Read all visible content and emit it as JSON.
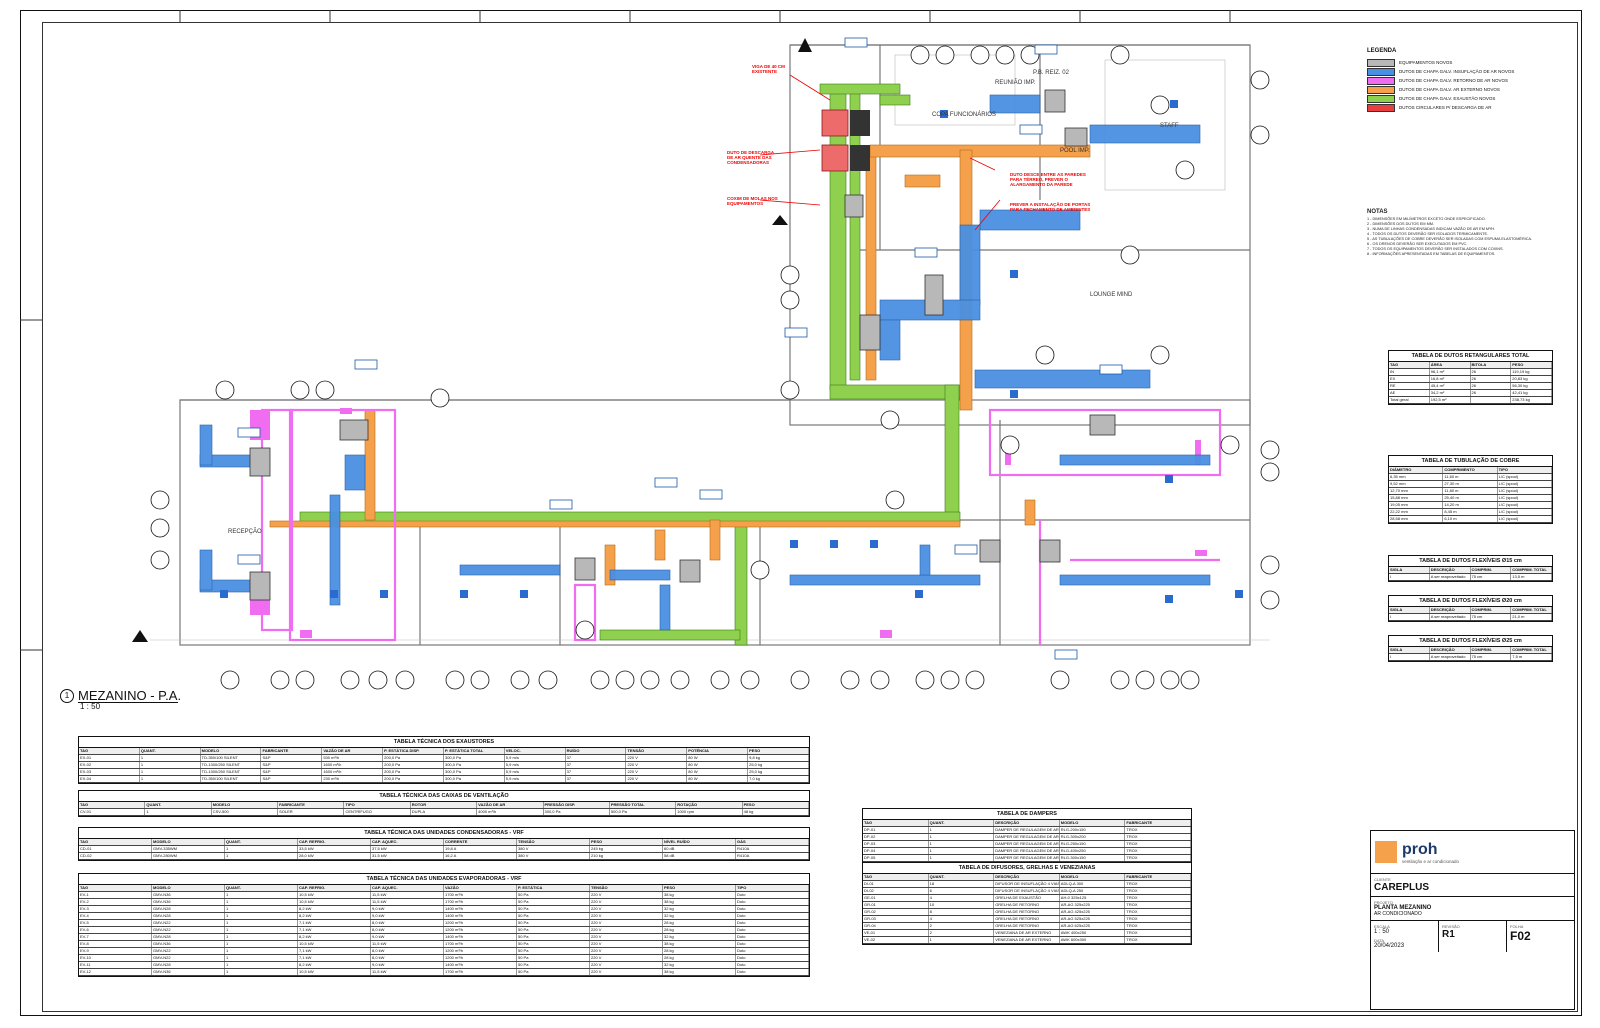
{
  "view": {
    "number": "1",
    "title": "MEZANINO - P.A.",
    "scale": "1 : 50"
  },
  "rooms": {
    "copa": "COPA FUNCIONÁRIOS",
    "reuniao": "REUNIÃO IMP.",
    "pbreiz": "P.B. REIZ. 02",
    "staff": "STAFF",
    "pool": "POOL IMP.",
    "lounge": "LOUNGE MIND",
    "recepcao": "RECEPÇÃO"
  },
  "red_notes": [
    "VIGA DE 40 CM EXISTENTE",
    "DUTO DE DESCARGA DE AR QUENTE DAS CONDENSADORAS",
    "COXIM DE MOLAS NOS EQUIPAMENTOS",
    "DUTO DESCE ENTRE AS PAREDES PARA TÉRREO, PREVER O ALARGAMENTO DA PAREDE",
    "PREVER A INSTALAÇÃO DE PORTAS PARA FECHAMENTO DE AMBIENTES"
  ],
  "legend": {
    "title": "LEGENDA",
    "items": [
      {
        "label": "EQUIPAMENTOS NOVOS",
        "color": "#b8b8b8"
      },
      {
        "label": "DUTOS DE CHAPA GALV. INSUFLAÇÃO DE AR NOVOS",
        "color": "#4a90e2"
      },
      {
        "label": "DUTOS DE CHAPA GALV. RETORNO DE AR NOVOS",
        "color": "#f06cf0"
      },
      {
        "label": "DUTOS DE CHAPA GALV. AR EXTERNO NOVOS",
        "color": "#f5a04a"
      },
      {
        "label": "DUTOS DE CHAPA GALV. EXAUSTÃO NOVOS",
        "color": "#8fd14f"
      },
      {
        "label": "DUTOS CIRCULARES P/ DESCARGA DE AR",
        "color": "#e84040"
      }
    ]
  },
  "notes": {
    "title": "NOTAS",
    "lines": [
      "1 - DIMENSÕES EM MILÍMETROS EXCETO ONDE ESPECIFICADO.",
      "2 - DIMENSÕES DOS DUTOS EM MM.",
      "3 - NUMA DE LINHAS CONDENSADAS INDICAM VAZÃO DE AR EM M³/H.",
      "4 - TODOS OS DUTOS DEVERÃO SER ISOLADOS TERMICAMENTE.",
      "5 - AS TUBULAÇÕES DE COBRE DEVERÃO SER ISOLADAS COM ESPUMA ELASTOMÉRICA.",
      "6 - OS DRENOS DEVERÃO SER EXECUTADOS EM PVC.",
      "7 - TODOS OS EQUIPAMENTOS DEVERÃO SER INSTALADOS COM COXINS.",
      "8 - INFORMAÇÕES APRESENTADAS EM TABELAS DE EQUIPAMENTOS."
    ]
  },
  "tables": {
    "retangulares": {
      "title": "TABELA DE DUTOS RETANGULARES TOTAL",
      "header": [
        "TAG",
        "ÁREA",
        "BITOLA",
        "PESO"
      ],
      "rows": [
        [
          "IN",
          "96,1 m²",
          "26",
          "119,19 kg"
        ],
        [
          "EX",
          "16,8 m²",
          "26",
          "20,83 kg"
        ],
        [
          "RE",
          "45,4 m²",
          "26",
          "56,30 kg"
        ],
        [
          "AE",
          "34,2 m²",
          "26",
          "42,41 kg"
        ],
        [
          "Total geral",
          "192,5 m²",
          "",
          "238,73 kg"
        ]
      ]
    },
    "cobre": {
      "title": "TABELA DE TUBULAÇÃO DE COBRE",
      "header": [
        "DIÂMETRO",
        "COMPRIMENTO",
        "TIPO"
      ],
      "rows": [
        [
          "6,35 mm",
          "11,60 m",
          "L/C (spool)"
        ],
        [
          "9,52 mm",
          "27,30 m",
          "L/C (spool)"
        ],
        [
          "12,70 mm",
          "11,80 m",
          "L/C (spool)"
        ],
        [
          "15,88 mm",
          "25,40 m",
          "L/C (spool)"
        ],
        [
          "19,05 mm",
          "14,20 m",
          "L/C (spool)"
        ],
        [
          "22,22 mm",
          "8,45 m",
          "L/C (spool)"
        ],
        [
          "28,58 mm",
          "6,10 m",
          "L/C (spool)"
        ]
      ]
    },
    "flex15": {
      "title": "TABELA DE DUTOS FLEXÍVEIS Ø15 cm",
      "header": [
        "SIGLA",
        "DESCRIÇÃO",
        "COMPRIM.",
        "COMPRIM. TOTAL"
      ],
      "rows": [
        [
          "I",
          "A ser reaproveitado",
          "75 cm",
          "13,5 m"
        ]
      ]
    },
    "flex20": {
      "title": "TABELA DE DUTOS FLEXÍVEIS Ø20 cm",
      "header": [
        "SIGLA",
        "DESCRIÇÃO",
        "COMPRIM.",
        "COMPRIM. TOTAL"
      ],
      "rows": [
        [
          "I",
          "A ser reaproveitado",
          "75 cm",
          "21,0 m"
        ]
      ]
    },
    "flex25": {
      "title": "TABELA DE DUTOS FLEXÍVEIS Ø25 cm",
      "header": [
        "SIGLA",
        "DESCRIÇÃO",
        "COMPRIM.",
        "COMPRIM. TOTAL"
      ],
      "rows": [
        [
          "I",
          "A ser reaproveitado",
          "75 cm",
          "7,5 m"
        ]
      ]
    },
    "exaustores": {
      "title": "TABELA TÉCNICA DOS EXAUSTORES",
      "header": [
        "TAG",
        "QUANT.",
        "MODELO",
        "FABRICANTE",
        "VAZÃO DE AR",
        "P. ESTÁTICA DISP.",
        "P. ESTÁTICA TOTAL",
        "VELOC.",
        "RUÍDO",
        "TENSÃO",
        "POTÊNCIA",
        "PESO"
      ],
      "rows": [
        [
          "EX-01",
          "1",
          "TD-350/100 SILENT",
          "S&P",
          "530 m³/h",
          "200,0 Pa",
          "300,0 Pa",
          "5,9 m/s",
          "37",
          "220 V",
          "80 W",
          "9,8 kg"
        ],
        [
          "EX-02",
          "1",
          "TD-1300/250 SILENT",
          "S&P",
          "1600 m³/h",
          "200,0 Pa",
          "300,0 Pa",
          "5,9 m/s",
          "37",
          "220 V",
          "80 W",
          "25,0 kg"
        ],
        [
          "EX-03",
          "1",
          "TD-1300/250 SILENT",
          "S&P",
          "1600 m³/h",
          "200,0 Pa",
          "300,0 Pa",
          "5,9 m/s",
          "37",
          "220 V",
          "80 W",
          "25,0 kg"
        ],
        [
          "EX-04",
          "1",
          "TD-350/100 SILENT",
          "S&P",
          "230 m³/h",
          "200,0 Pa",
          "300,0 Pa",
          "5,9 m/s",
          "37",
          "220 V",
          "80 W",
          "7,0 kg"
        ]
      ]
    },
    "caixas": {
      "title": "TABELA TÉCNICA DAS CAIXAS DE VENTILAÇÃO",
      "header": [
        "TAG",
        "QUANT.",
        "MODELO",
        "FABRICANTE",
        "TIPO",
        "ROTOR",
        "VAZÃO DE AR",
        "PRESSÃO DISP.",
        "PRESSÃO TOTAL",
        "ROTAÇÃO",
        "PESO"
      ],
      "rows": [
        [
          "CV-01",
          "1",
          "CSV-500",
          "SOLER",
          "CENTRÍFUGO",
          "DUPLA",
          "4000 m³/h",
          "300,0 Pa",
          "500,0 Pa",
          "1000 rpm",
          "48 kg"
        ]
      ]
    },
    "condensadoras": {
      "title": "TABELA TÉCNICA DAS UNIDADES CONDENSADORAS - VRF",
      "header": [
        "TAG",
        "MODELO",
        "QUANT.",
        "CAP. REFRIG.",
        "CAP. AQUEC.",
        "CORRENTE",
        "TENSÃO",
        "PESO",
        "NÍVEL RUÍDO",
        "GÁS"
      ],
      "rows": [
        [
          "CD-01",
          "GMV-335WM",
          "1",
          "33,5 kW",
          "37,5 kW",
          "19,8 A",
          "380 V",
          "245 kg",
          "60 dB",
          "R410A"
        ],
        [
          "CD-02",
          "GMV-280WM",
          "1",
          "28,0 kW",
          "31,5 kW",
          "16,2 A",
          "380 V",
          "210 kg",
          "58 dB",
          "R410A"
        ]
      ]
    },
    "evaporadoras": {
      "title": "TABELA TÉCNICA DAS UNIDADES EVAPORADORAS - VRF",
      "header": [
        "TAG",
        "MODELO",
        "QUANT.",
        "CAP. REFRIG.",
        "CAP. AQUEC.",
        "VAZÃO",
        "P. ESTÁTICA",
        "TENSÃO",
        "PESO",
        "TIPO"
      ],
      "rows": [
        [
          "EV-1",
          "GMV-N36",
          "1",
          "10,5 kW",
          "11,5 kW",
          "1700 m³/h",
          "50 Pa",
          "220 V",
          "38 kg",
          "Duto"
        ],
        [
          "EV-2",
          "GMV-N36",
          "1",
          "10,5 kW",
          "11,5 kW",
          "1700 m³/h",
          "50 Pa",
          "220 V",
          "38 kg",
          "Duto"
        ],
        [
          "EV-3",
          "GMV-N28",
          "1",
          "8,2 kW",
          "9,0 kW",
          "1400 m³/h",
          "50 Pa",
          "220 V",
          "32 kg",
          "Duto"
        ],
        [
          "EV-4",
          "GMV-N28",
          "1",
          "8,2 kW",
          "9,0 kW",
          "1400 m³/h",
          "50 Pa",
          "220 V",
          "32 kg",
          "Duto"
        ],
        [
          "EV-5",
          "GMV-N22",
          "1",
          "7,1 kW",
          "8,0 kW",
          "1200 m³/h",
          "50 Pa",
          "220 V",
          "28 kg",
          "Duto"
        ],
        [
          "EV-6",
          "GMV-N22",
          "1",
          "7,1 kW",
          "8,0 kW",
          "1200 m³/h",
          "50 Pa",
          "220 V",
          "28 kg",
          "Duto"
        ],
        [
          "EV-7",
          "GMV-N28",
          "1",
          "8,2 kW",
          "9,0 kW",
          "1400 m³/h",
          "50 Pa",
          "220 V",
          "32 kg",
          "Duto"
        ],
        [
          "EV-8",
          "GMV-N36",
          "1",
          "10,5 kW",
          "11,5 kW",
          "1700 m³/h",
          "50 Pa",
          "220 V",
          "38 kg",
          "Duto"
        ],
        [
          "EV-9",
          "GMV-N22",
          "1",
          "7,1 kW",
          "8,0 kW",
          "1200 m³/h",
          "50 Pa",
          "220 V",
          "28 kg",
          "Duto"
        ],
        [
          "EV-10",
          "GMV-N22",
          "1",
          "7,1 kW",
          "8,0 kW",
          "1200 m³/h",
          "50 Pa",
          "220 V",
          "28 kg",
          "Duto"
        ],
        [
          "EV-11",
          "GMV-N28",
          "1",
          "8,2 kW",
          "9,0 kW",
          "1400 m³/h",
          "50 Pa",
          "220 V",
          "32 kg",
          "Duto"
        ],
        [
          "EV-12",
          "GMV-N36",
          "1",
          "10,5 kW",
          "11,5 kW",
          "1700 m³/h",
          "50 Pa",
          "220 V",
          "38 kg",
          "Duto"
        ]
      ]
    },
    "dampers": {
      "title": "TABELA DE DAMPERS",
      "header": [
        "TAG",
        "QUANT.",
        "DESCRIÇÃO",
        "MODELO",
        "FABRICANTE"
      ],
      "rows": [
        [
          "DP-01",
          "1",
          "DAMPER DE REGULAGEM DE AR",
          "RLG-200x150",
          "TROX"
        ],
        [
          "DP-02",
          "1",
          "DAMPER DE REGULAGEM DE AR",
          "RLG-300x200",
          "TROX"
        ],
        [
          "DP-03",
          "1",
          "DAMPER DE REGULAGEM DE AR",
          "RLG-250x150",
          "TROX"
        ],
        [
          "DP-04",
          "1",
          "DAMPER DE REGULAGEM DE AR",
          "RLG-400x250",
          "TROX"
        ],
        [
          "DP-05",
          "1",
          "DAMPER DE REGULAGEM DE AR",
          "RLG-300x150",
          "TROX"
        ]
      ]
    },
    "difusores": {
      "title": "TABELA DE DIFUSORES, GRELHAS E VENEZIANAS",
      "header": [
        "TAG",
        "QUANT.",
        "DESCRIÇÃO",
        "MODELO",
        "FABRICANTE"
      ],
      "rows": [
        [
          "DI-01",
          "18",
          "DIFUSOR DE INSUFLAÇÃO 4 VIAS",
          "ADLQ-A 300",
          "TROX"
        ],
        [
          "DI-02",
          "6",
          "DIFUSOR DE INSUFLAÇÃO 4 VIAS",
          "ADLQ-A 250",
          "TROX"
        ],
        [
          "GE-01",
          "4",
          "GRELHA DE EXAUSTÃO",
          "AH-0 325x125",
          "TROX"
        ],
        [
          "GR-01",
          "10",
          "GRELHA DE RETORNO",
          "AR-AG 325x225",
          "TROX"
        ],
        [
          "GR-02",
          "8",
          "GRELHA DE RETORNO",
          "AR-AG 425x225",
          "TROX"
        ],
        [
          "GR-03",
          "4",
          "GRELHA DE RETORNO",
          "AR-AG 525x225",
          "TROX"
        ],
        [
          "GR-04",
          "2",
          "GRELHA DE RETORNO",
          "AR-AG 625x225",
          "TROX"
        ],
        [
          "VE-01",
          "2",
          "VENEZIANA DE AR EXTERNO",
          "AWK 400x250",
          "TROX"
        ],
        [
          "VE-02",
          "1",
          "VENEZIANA DE AR EXTERNO",
          "AWK 600x300",
          "TROX"
        ]
      ]
    }
  },
  "title_block": {
    "company": "proh",
    "tagline": "ventilação e ar condicionado",
    "client_label": "CLIENTE",
    "client": "CAREPLUS",
    "project_label": "PROJETO",
    "project": "PLANTA MEZANINO",
    "revision_label": "REVISÃO",
    "revision": "R1",
    "sheet_label": "FOLHA",
    "sheet": "F02",
    "scale_label": "ESCALA",
    "scale": "1 : 50",
    "date_label": "DATA",
    "date": "20/04/2023",
    "discipline": "AR CONDICIONADO"
  },
  "colors": {
    "supply": "#4a90e2",
    "return": "#f06cf0",
    "outdoor": "#f5a04a",
    "exhaust": "#8fd14f",
    "discharge": "#e84040",
    "equipment": "#b8b8b8"
  }
}
